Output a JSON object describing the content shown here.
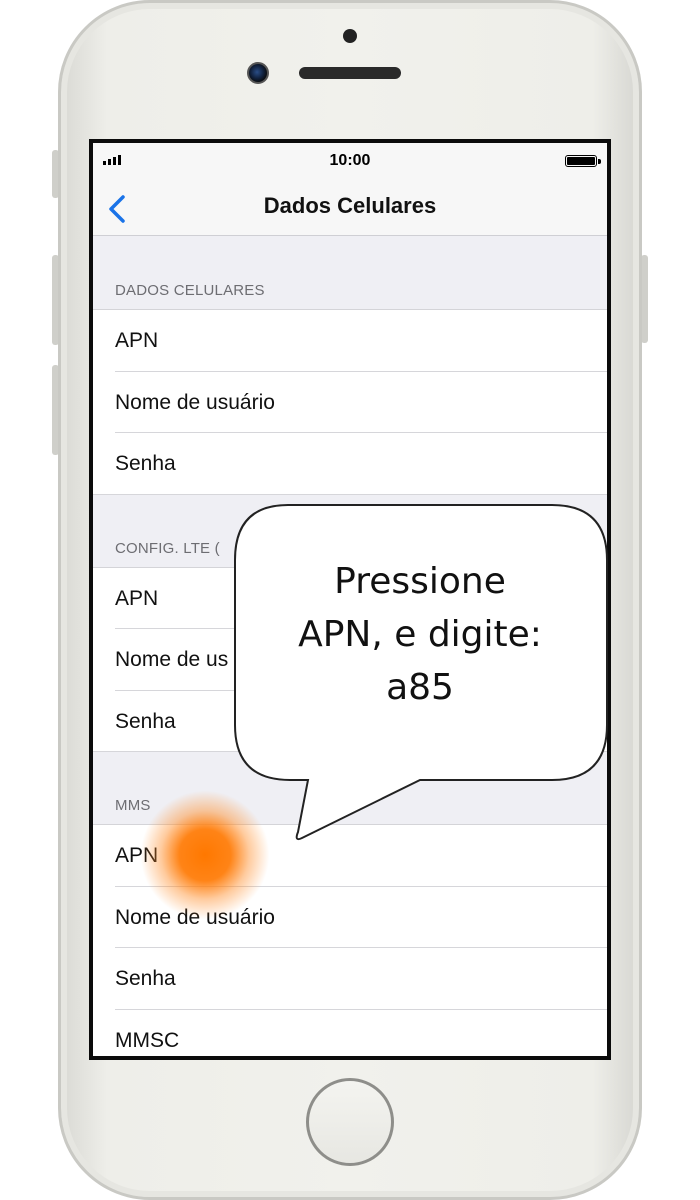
{
  "status_bar": {
    "time": "10:00"
  },
  "nav": {
    "title": "Dados Celulares",
    "back_icon": "chevron-left-icon",
    "accent_color": "#1a73e8"
  },
  "sections": [
    {
      "header": "DADOS CELULARES",
      "items": [
        "APN",
        "Nome de usuário",
        "Senha"
      ]
    },
    {
      "header": "CONFIG. LTE (",
      "items": [
        "APN",
        "Nome de us",
        "Senha"
      ]
    },
    {
      "header": "MMS",
      "items": [
        "APN",
        "Nome de usuário",
        "Senha",
        "MMSC"
      ]
    }
  ],
  "callout": {
    "lines": [
      "Pressione",
      "APN, e digite:",
      "a85"
    ]
  },
  "touch_indicator": {
    "color": "#ff7a00"
  }
}
